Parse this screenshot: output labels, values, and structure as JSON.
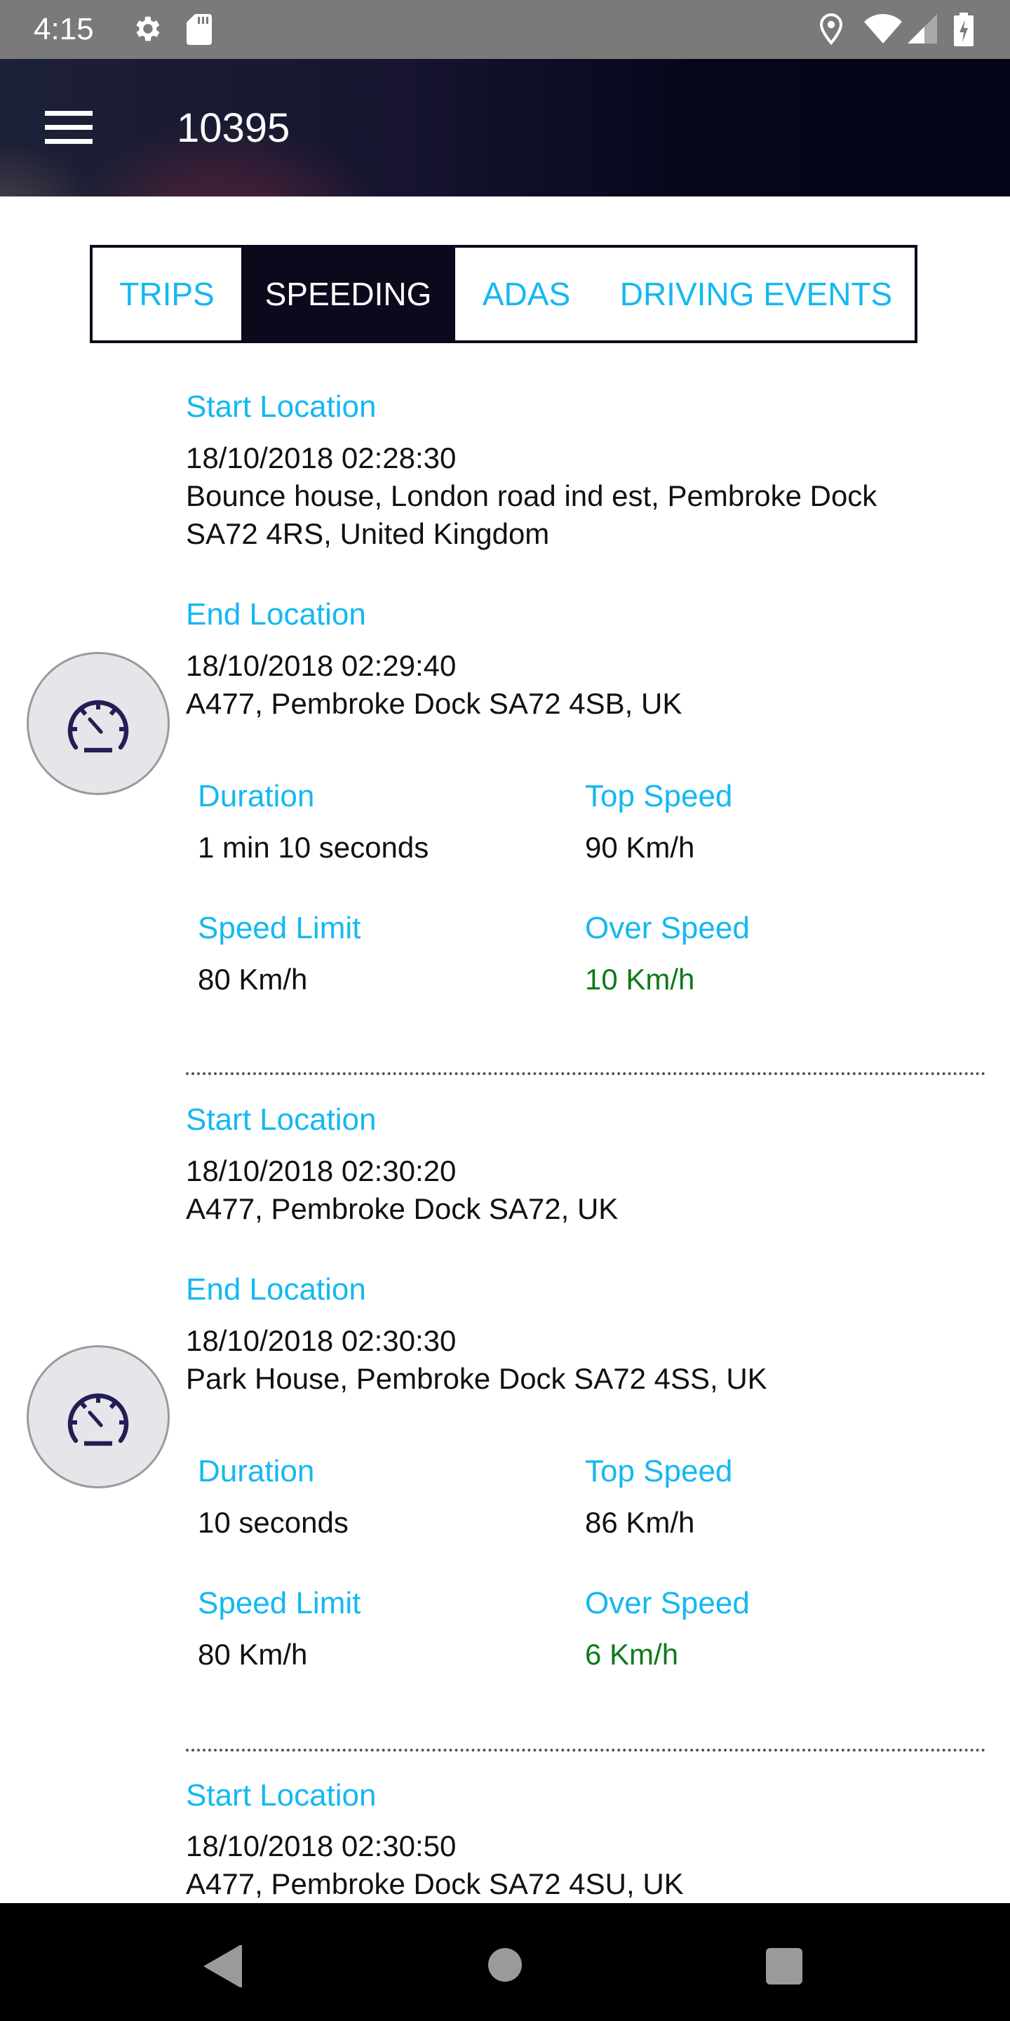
{
  "status_bar": {
    "time": "4:15",
    "left_icons": [
      "settings-gear-icon",
      "sd-card-icon"
    ],
    "right_icons": [
      "location-pin-icon",
      "wifi-icon",
      "cell-signal-icon",
      "battery-charging-icon"
    ]
  },
  "app_bar": {
    "menu_icon": "hamburger-menu-icon",
    "title": "10395"
  },
  "tabs": [
    {
      "label": "TRIPS",
      "active": false
    },
    {
      "label": "SPEEDING",
      "active": true
    },
    {
      "label": "ADAS",
      "active": false
    },
    {
      "label": "DRIVING EVENTS",
      "active": false
    }
  ],
  "labels": {
    "start_location": "Start Location",
    "end_location": "End Location",
    "duration": "Duration",
    "top_speed": "Top Speed",
    "speed_limit": "Speed Limit",
    "over_speed": "Over Speed"
  },
  "records": [
    {
      "icon": "speedometer-icon",
      "start_time": "18/10/2018 02:28:30",
      "start_address_line1": "Bounce house, London road ind est, Pembroke Dock",
      "start_address_line2": "SA72 4RS, United Kingdom",
      "end_time": "18/10/2018 02:29:40",
      "end_address": "A477, Pembroke Dock SA72 4SB, UK",
      "duration": "1 min 10 seconds",
      "top_speed": "90 Km/h",
      "speed_limit": "80 Km/h",
      "over_speed": "10 Km/h"
    },
    {
      "icon": "speedometer-icon",
      "start_time": "18/10/2018 02:30:20",
      "start_address": "A477, Pembroke Dock SA72, UK",
      "end_time": "18/10/2018 02:30:30",
      "end_address": "Park House, Pembroke Dock SA72 4SS, UK",
      "duration": "10 seconds",
      "top_speed": "86 Km/h",
      "speed_limit": "80 Km/h",
      "over_speed": "6 Km/h"
    },
    {
      "start_time": "18/10/2018 02:30:50",
      "start_address": "A477, Pembroke Dock SA72 4SU, UK"
    }
  ],
  "colors": {
    "accent": "#14b8f0",
    "tab_active_bg": "#0b0a1c",
    "over_speed": "#0f7a1a"
  },
  "nav_bar": [
    "back-icon",
    "home-icon",
    "recents-icon"
  ]
}
